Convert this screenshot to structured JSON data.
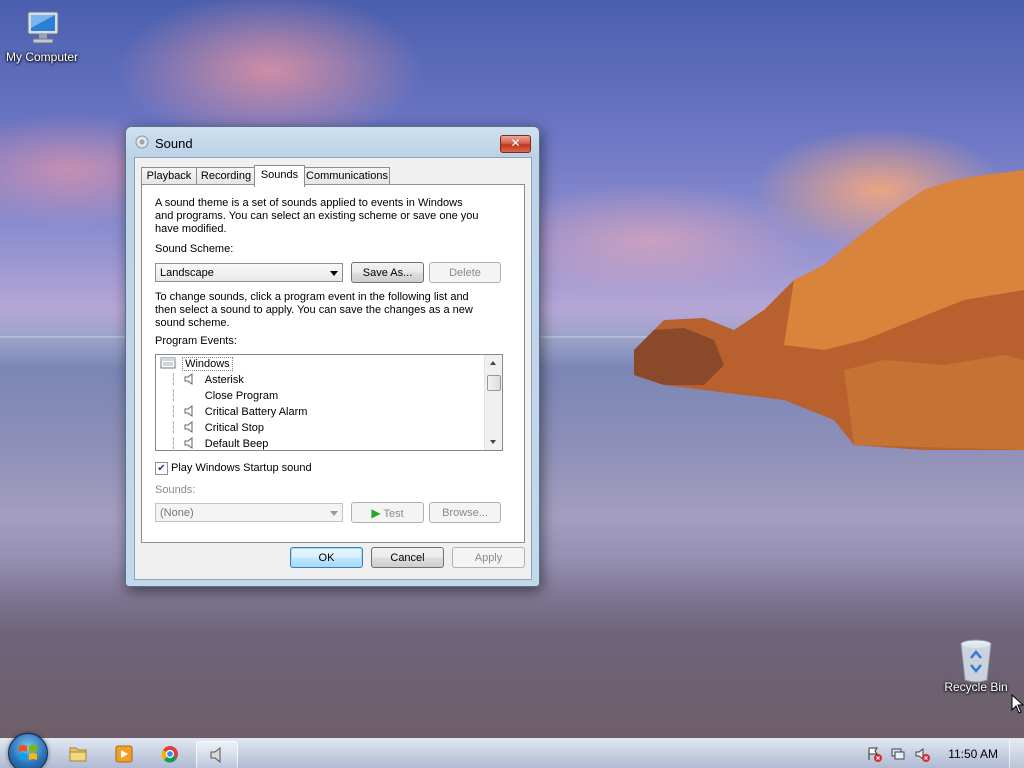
{
  "desktop": {
    "icons": [
      {
        "label": "My Computer"
      },
      {
        "label": "Recycle Bin"
      }
    ]
  },
  "dialog": {
    "title": "Sound",
    "tabs": [
      {
        "label": "Playback"
      },
      {
        "label": "Recording"
      },
      {
        "label": "Sounds",
        "active": true
      },
      {
        "label": "Communications"
      }
    ],
    "intro_text_lines": [
      "A sound theme is a set of sounds applied to events in Windows",
      "and programs.  You can select an existing scheme or save one you",
      "have modified."
    ],
    "scheme_label": "Sound Scheme:",
    "scheme_value": "Landscape",
    "save_as_label": "Save As...",
    "delete_label": "Delete",
    "instructions_lines": [
      "To change sounds, click a program event in the following list and",
      "then select a sound to apply.  You can save the changes as a new",
      "sound scheme."
    ],
    "program_events_label": "Program Events:",
    "events": [
      {
        "label": "Windows",
        "level": 0,
        "has_sound": false
      },
      {
        "label": "Asterisk",
        "level": 1,
        "has_sound": true
      },
      {
        "label": "Close Program",
        "level": 1,
        "has_sound": false
      },
      {
        "label": "Critical Battery Alarm",
        "level": 1,
        "has_sound": true
      },
      {
        "label": "Critical Stop",
        "level": 1,
        "has_sound": true
      },
      {
        "label": "Default Beep",
        "level": 1,
        "has_sound": true
      }
    ],
    "startup_sound_label": "Play Windows Startup sound",
    "startup_sound_checked": true,
    "sounds_label": "Sounds:",
    "sounds_value": "(None)",
    "test_label": "Test",
    "browse_label": "Browse...",
    "ok_label": "OK",
    "cancel_label": "Cancel",
    "apply_label": "Apply"
  },
  "taskbar": {
    "pinned": [
      "start-orb",
      "explorer-icon",
      "media-player-icon",
      "chrome-icon",
      "speaker-icon"
    ],
    "tray": [
      "action-center-icon",
      "network-icon",
      "volume-muted-icon"
    ],
    "clock": "11:50 AM"
  },
  "colors": {
    "close_button": "#c2341c",
    "selection_accent": "#3c7fb1",
    "test_play": "#2aa52a"
  }
}
